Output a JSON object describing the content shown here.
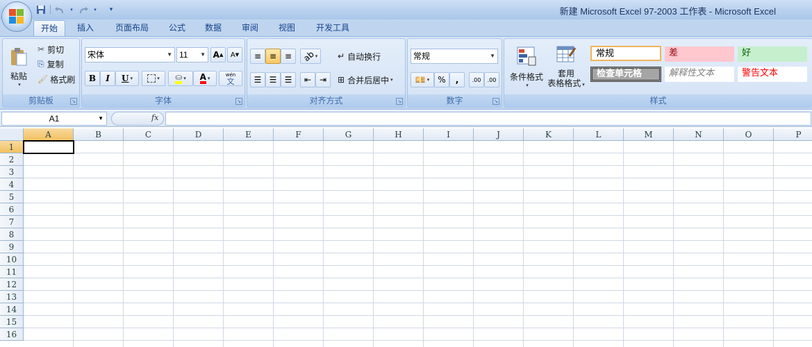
{
  "window": {
    "title": "新建 Microsoft Excel 97-2003 工作表 - Microsoft Excel"
  },
  "quick_access": {
    "save_icon": "save-icon",
    "undo_icon": "undo-icon",
    "redo_icon": "redo-icon",
    "customize_icon": "chevron-down-icon"
  },
  "tabs": [
    {
      "label": "开始",
      "active": true
    },
    {
      "label": "插入"
    },
    {
      "label": "页面布局"
    },
    {
      "label": "公式"
    },
    {
      "label": "数据"
    },
    {
      "label": "审阅"
    },
    {
      "label": "视图"
    },
    {
      "label": "开发工具"
    }
  ],
  "clipboard": {
    "group_label": "剪贴板",
    "paste": "粘贴",
    "cut": "剪切",
    "copy": "复制",
    "format_painter": "格式刷"
  },
  "font": {
    "group_label": "字体",
    "family": "宋体",
    "size": "11",
    "bold": "B",
    "italic": "I",
    "underline": "U",
    "font_color_letter": "A",
    "phonetic": "wén",
    "phonetic_char": "文",
    "grow": "A",
    "shrink": "A"
  },
  "alignment": {
    "group_label": "对齐方式",
    "wrap_text": "自动换行",
    "merge_center": "合并后居中"
  },
  "number": {
    "group_label": "数字",
    "format": "常规",
    "percent": "%",
    "comma": ",",
    "increase_decimal": ".00",
    "decrease_decimal": ".00"
  },
  "styles_group": {
    "group_label": "样式",
    "conditional_format": "条件格式",
    "table_format_line1": "套用",
    "table_format_line2": "表格格式",
    "cells": {
      "normal": "常规",
      "bad": "差",
      "good": "好",
      "check_cell": "检查单元格",
      "explanatory": "解释性文本",
      "warning": "警告文本"
    }
  },
  "formula_bar": {
    "name_box": "A1",
    "fx_label": "fx",
    "formula": ""
  },
  "grid": {
    "columns": [
      "A",
      "B",
      "C",
      "D",
      "E",
      "F",
      "G",
      "H",
      "I",
      "J",
      "K",
      "L",
      "M",
      "N",
      "O",
      "P"
    ],
    "rows": [
      "1",
      "2",
      "3",
      "4",
      "5",
      "6",
      "7",
      "8",
      "9",
      "10",
      "11",
      "12",
      "13",
      "14",
      "15",
      "16"
    ],
    "active_cell": "A1"
  },
  "colors": {
    "accent": "#15428b",
    "ribbon": "#dbe7f6",
    "bad_fill": "#ffc7ce",
    "good_fill": "#c6efce",
    "warning_text": "#c00000"
  }
}
